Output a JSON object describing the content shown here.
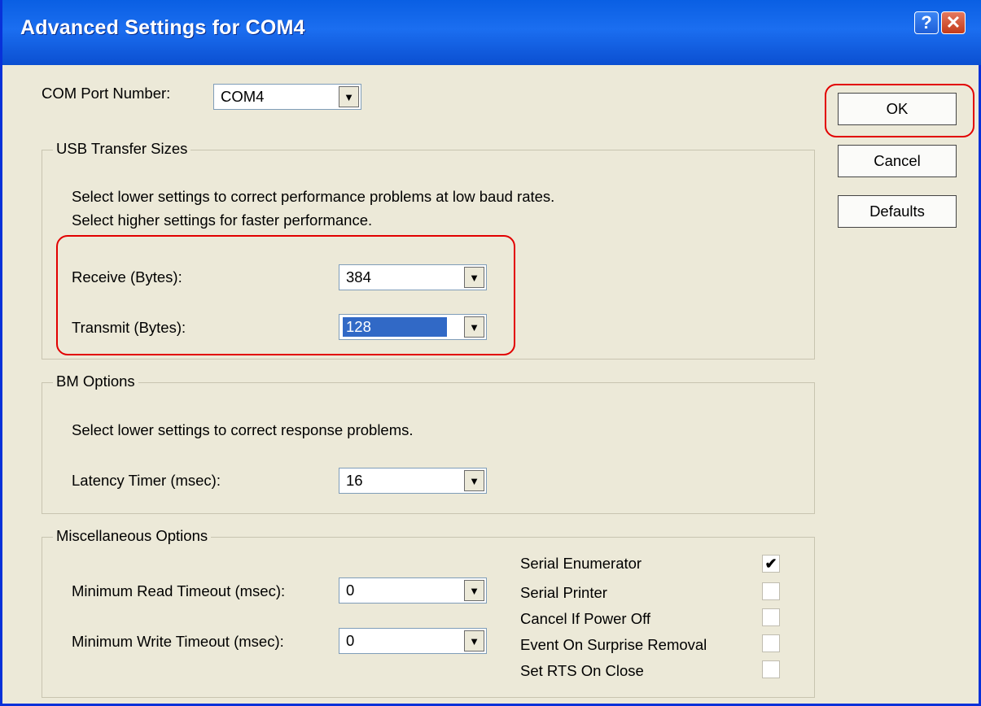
{
  "window": {
    "title": "Advanced Settings for COM4",
    "help_label": "?",
    "close_label": "✕"
  },
  "com_port": {
    "label": "COM Port Number:",
    "value": "COM4"
  },
  "buttons": {
    "ok": "OK",
    "cancel": "Cancel",
    "defaults": "Defaults"
  },
  "usb_transfer": {
    "title": "USB Transfer Sizes",
    "desc1": "Select lower settings to correct performance problems at low baud rates.",
    "desc2": "Select higher settings for faster performance.",
    "receive_label": "Receive (Bytes):",
    "receive_value": "384",
    "transmit_label": "Transmit (Bytes):",
    "transmit_value": "128"
  },
  "bm_options": {
    "title": "BM Options",
    "desc": "Select lower settings to correct response problems.",
    "latency_label": "Latency Timer (msec):",
    "latency_value": "16"
  },
  "misc_options": {
    "title": "Miscellaneous Options",
    "min_read_label": "Minimum Read Timeout (msec):",
    "min_read_value": "0",
    "min_write_label": "Minimum Write Timeout (msec):",
    "min_write_value": "0",
    "checkboxes": [
      {
        "label": "Serial Enumerator",
        "checked": "✔"
      },
      {
        "label": "Serial Printer",
        "checked": ""
      },
      {
        "label": "Cancel If Power Off",
        "checked": ""
      },
      {
        "label": "Event On Surprise Removal",
        "checked": ""
      },
      {
        "label": "Set RTS On Close",
        "checked": ""
      }
    ]
  },
  "icons": {
    "dropdown": "▼"
  }
}
